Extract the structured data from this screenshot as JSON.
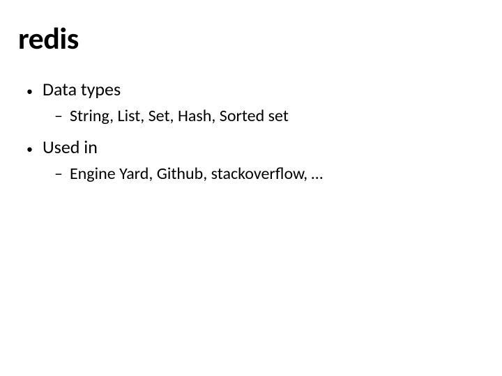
{
  "title": "redis",
  "items": [
    {
      "label": "Data types",
      "sub": "String, List, Set, Hash, Sorted set"
    },
    {
      "label": "Used in",
      "sub": "Engine Yard, Github, stackoverflow, …"
    }
  ]
}
